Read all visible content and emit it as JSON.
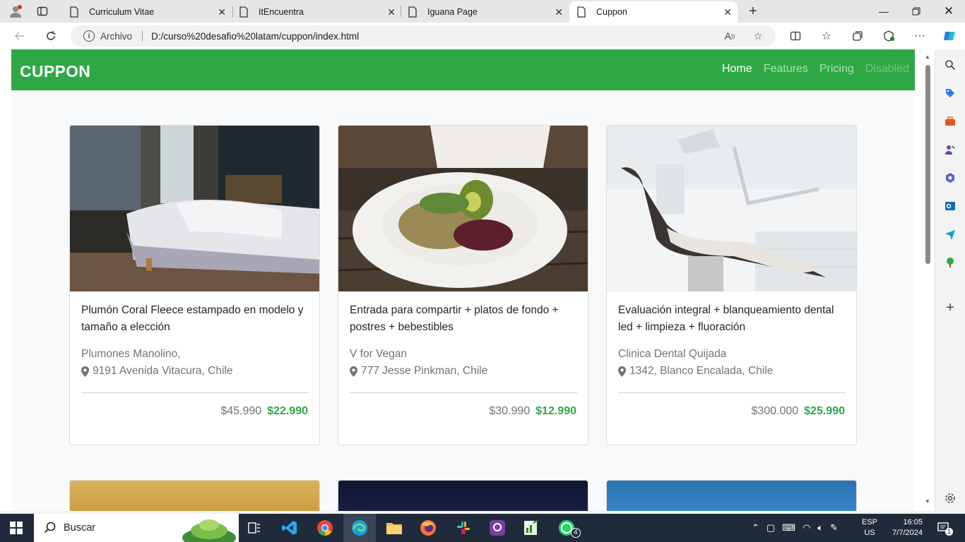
{
  "browser": {
    "tabs": [
      {
        "title": "Curriculum Vitae"
      },
      {
        "title": "ItEncuentra"
      },
      {
        "title": "Iguana Page"
      },
      {
        "title": "Cuppon"
      }
    ],
    "address": {
      "protocol_label": "Archivo",
      "url": "D:/curso%20desafio%20latam/cuppon/index.html"
    }
  },
  "site": {
    "brand": "CUPPON",
    "nav": [
      "Home",
      "Features",
      "Pricing",
      "Disabled"
    ],
    "accent_color": "#2ea845"
  },
  "cards": [
    {
      "title": "Plumón Coral Fleece estampado en modelo y tamaño a elección",
      "company": "Plumones Manolino,",
      "location": "9191 Avenida Vitacura, Chile",
      "old_price": "$45.990",
      "new_price": "$22.990",
      "image": "bedroom-bed-photo"
    },
    {
      "title": "Entrada para compartir + platos de fondo + postres + bebestibles",
      "company": "V for Vegan",
      "location": "777 Jesse Pinkman, Chile",
      "old_price": "$30.990",
      "new_price": "$12.990",
      "image": "vegan-salad-plate-photo"
    },
    {
      "title": "Evaluación integral + blanqueamiento dental led + limpieza + fluoración",
      "company": "Clinica Dental Quijada",
      "location": "1342, Blanco Encalada, Chile",
      "old_price": "$300.000",
      "new_price": "$25.990",
      "image": "dental-chair-photo"
    }
  ],
  "taskbar": {
    "search_label": "Buscar",
    "language": "ESP",
    "keyboard": "US",
    "time": "16:05",
    "date": "7/7/2024",
    "whatsapp_badge": "4",
    "notifications": "1"
  }
}
